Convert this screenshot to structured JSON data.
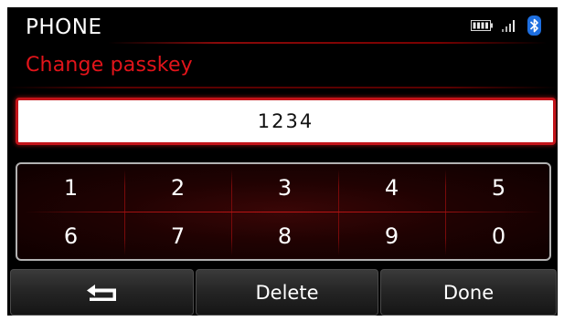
{
  "header": {
    "title": "PHONE",
    "status_icons": [
      "battery-icon",
      "signal-icon",
      "bluetooth-icon"
    ]
  },
  "subtitle": "Change passkey",
  "passkey": {
    "value": "1234"
  },
  "keypad": {
    "keys": [
      "1",
      "2",
      "3",
      "4",
      "5",
      "6",
      "7",
      "8",
      "9",
      "0"
    ]
  },
  "bottom_bar": {
    "back_icon": "back-arrow-icon",
    "delete_label": "Delete",
    "done_label": "Done"
  },
  "colors": {
    "accent": "#e2141a",
    "background": "#000000",
    "bluetooth": "#1e6fe0"
  }
}
